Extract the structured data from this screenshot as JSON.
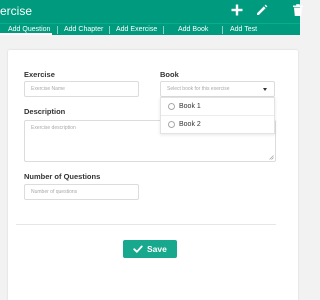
{
  "appbar": {
    "title": "ercise",
    "actions": [
      {
        "icon": "plus-icon"
      },
      {
        "icon": "pencil-icon"
      },
      {
        "icon": "trash-icon"
      }
    ]
  },
  "tabs": [
    {
      "label": "Add Question"
    },
    {
      "label": "Add Chapter"
    },
    {
      "label": "Add Exercise"
    },
    {
      "label": "Add Book"
    },
    {
      "label": "Add Test"
    }
  ],
  "form": {
    "exercise": {
      "label": "Exercise",
      "placeholder": "Exercise Name"
    },
    "book": {
      "label": "Book",
      "placeholder": "Select book for this exercise",
      "options": [
        {
          "label": "Book 1"
        },
        {
          "label": "Book 2"
        }
      ]
    },
    "description": {
      "label": "Description",
      "placeholder": "Exercise description"
    },
    "num_questions": {
      "label": "Number of Questions",
      "placeholder": "Number of questions"
    }
  },
  "save": {
    "label": "Save",
    "icon": "check-icon"
  },
  "colors": {
    "primary": "#009a7e",
    "button": "#18a88d",
    "background": "#f2f2f2"
  }
}
